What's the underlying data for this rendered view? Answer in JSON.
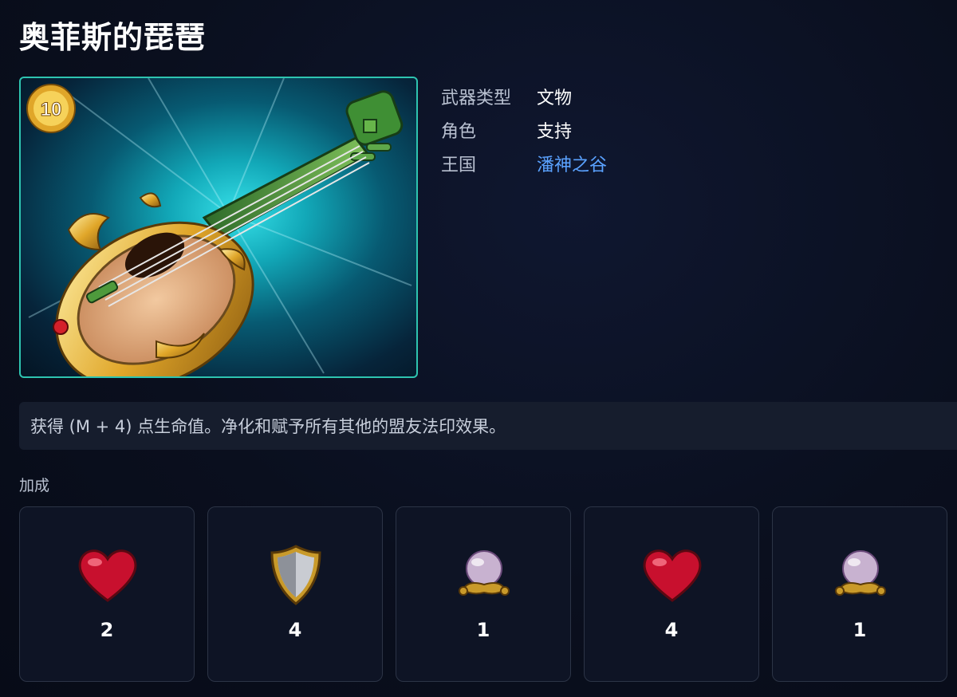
{
  "page": {
    "title": "奥菲斯的琵琶"
  },
  "hero": {
    "level": "10",
    "icon": "lute-icon"
  },
  "info": {
    "weapon_type_label": "武器类型",
    "weapon_type_value": "文物",
    "role_label": "角色",
    "role_value": "支持",
    "kingdom_label": "王国",
    "kingdom_value": "潘神之谷"
  },
  "description": "获得 (M + 4) 点生命值。净化和赋予所有其他的盟友法印效果。",
  "bonus": {
    "heading": "加成",
    "items": [
      {
        "icon": "heart-icon",
        "count": "2"
      },
      {
        "icon": "shield-icon",
        "count": "4"
      },
      {
        "icon": "crystal-orb-icon",
        "count": "1"
      },
      {
        "icon": "heart-icon",
        "count": "4"
      },
      {
        "icon": "crystal-orb-icon",
        "count": "1"
      }
    ]
  },
  "colors": {
    "frame_border": "#2ec4b0",
    "link": "#5aa2ff",
    "background": "#0a0f1e"
  }
}
